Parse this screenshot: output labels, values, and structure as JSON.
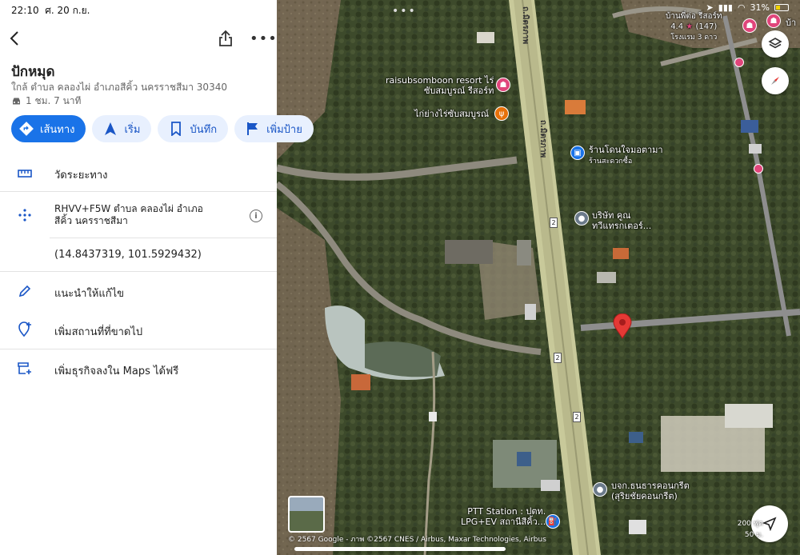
{
  "status": {
    "time": "22:10",
    "date": "ศ. 20 ก.ย.",
    "battery": "31%"
  },
  "panel": {
    "title": "ปักหมุด",
    "address": "ใกล้ ตำบล คลองไผ่ อำเภอสีคิ้ว นครราชสีมา 30340",
    "eta": "1 ชม. 7 นาที",
    "actions": [
      {
        "label": "เส้นทาง",
        "icon": "directions-icon"
      },
      {
        "label": "เริ่ม",
        "icon": "navigation-arrow-icon"
      },
      {
        "label": "บันทึก",
        "icon": "bookmark-icon"
      },
      {
        "label": "เพิ่มป้าย",
        "icon": "flag-icon"
      }
    ],
    "rows": {
      "measure": "วัดระยะทาง",
      "plus_code_line1": "RHVV+F5W ตำบล คลองไผ่ อำเภอ",
      "plus_code_line2": "สีคิ้ว นครราชสีมา",
      "coords": "(14.8437319, 101.5929432)",
      "suggest_edit": "แนะนำให้แก้ไข",
      "add_missing": "เพิ่มสถานที่ที่ขาดไป",
      "add_business": "เพิ่มธุรกิจลงใน Maps ได้ฟรี"
    }
  },
  "map": {
    "labels": {
      "resort": "raisubsomboon resort ไร่",
      "resort2": "ซับสมบูรณ์ รีสอร์ท",
      "restaurant": "ไก่ย่างไร่ซับสมบูรณ์",
      "shop1": "ร้านโดนใจมอตามา",
      "shop1_sub": "ร้านสะดวกซื้อ",
      "company1": "บริษัท คูณ",
      "company2": "ทวีแทรกเตอร์...",
      "concrete1": "บจก.ธนธารคอนกรีต",
      "concrete2": "(สุริยชัยคอนกรีต)",
      "ptt1": "PTT Station : ปตท.",
      "ptt2": "LPG+EV สถานีสีคิ้ว...",
      "hotel": "บ้านพี่ต่อ รีสอร์ท",
      "hotel_rating": "4.4",
      "hotel_reviews": "(147)",
      "hotel_type": "โรงแรม 3 ดาว",
      "hotel_edge": "บ้า",
      "road1": "ถ.มิตรภาพ",
      "road2": "ถ.มิตรภาพ",
      "route_num": "2"
    },
    "copyright": "© 2567 Google - ภาพ ©2567 CNES / Airbus, Maxar Technologies, Airbus",
    "scale_ft": "200 ฟุต",
    "scale_m": "50 ม."
  }
}
